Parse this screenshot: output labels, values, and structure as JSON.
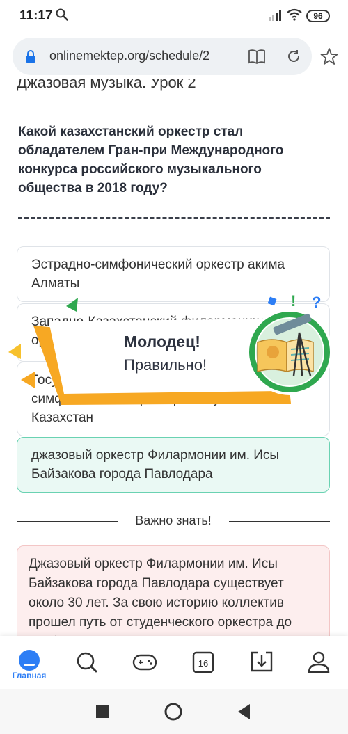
{
  "status_bar": {
    "time": "11:17",
    "battery": "96",
    "icons": [
      "search-icon",
      "signal-icon",
      "wifi-icon",
      "battery-icon"
    ]
  },
  "browser": {
    "url": "onlinemektep.org/schedule/2",
    "icons": [
      "lock-icon",
      "reader-icon",
      "reload-icon",
      "star-icon"
    ]
  },
  "lesson": {
    "title": "Джазовая музыка. Урок 2"
  },
  "question": {
    "text": "Какой казахстанский оркестр стал обладателем Гран-при Международного конкурса российского музыкального общества в 2018 году?"
  },
  "options": [
    {
      "text": "Эстрадно-симфонический оркестр акима Алматы",
      "state": "default"
    },
    {
      "text": "Западно-Казахстанский филармонический оркестр",
      "state": "default"
    },
    {
      "text": "Государственный академический симфонический оркестр Республики Казахстан",
      "state": "default"
    },
    {
      "text": "джазовый оркестр Филармонии им. Исы Байзакова города Павлодара",
      "state": "correct"
    }
  ],
  "important": {
    "heading": "Важно знать!",
    "text": "Джазовый оркестр Филармонии им. Исы Байзакова города Павлодара существует около 30 лет. За свою историю коллектив прошел путь от студенческого оркестра до профессионального коллектива."
  },
  "feedback": {
    "title": "Молодец!",
    "subtitle": "Правильно!"
  },
  "bottom_nav": {
    "items": [
      {
        "label": "Главная",
        "icon": "home-icon",
        "active": true
      },
      {
        "label": "",
        "icon": "search-icon",
        "active": false
      },
      {
        "label": "",
        "icon": "gamepad-icon",
        "active": false
      },
      {
        "label": "16",
        "icon": "calendar-icon",
        "active": false
      },
      {
        "label": "",
        "icon": "inbox-download-icon",
        "active": false
      },
      {
        "label": "",
        "icon": "profile-icon",
        "active": false
      }
    ]
  },
  "colors": {
    "accent_blue": "#2d7ef5",
    "correct_bg": "#eaf9f4",
    "correct_border": "#6ad2b2",
    "info_bg": "#fdeeee",
    "popup_orange": "#f7a823",
    "badge_green": "#2fa84f"
  }
}
